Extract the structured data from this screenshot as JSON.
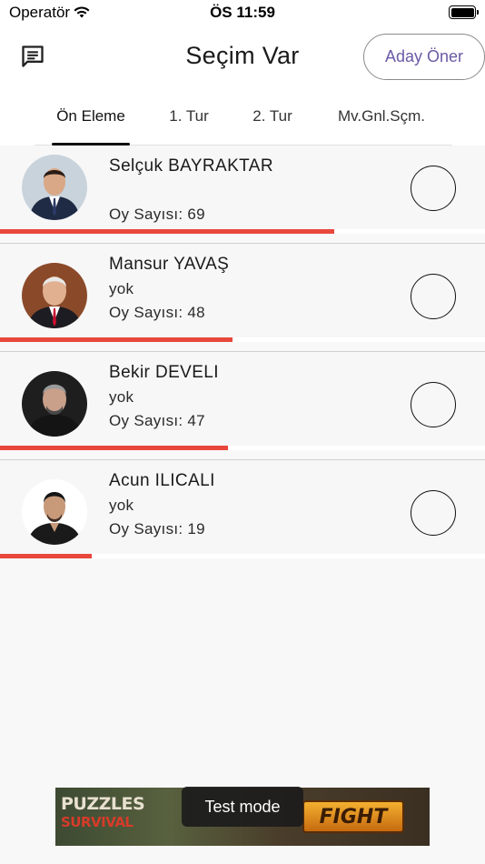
{
  "status_bar": {
    "carrier": "Operatör",
    "time": "ÖS 11:59"
  },
  "header": {
    "title": "Seçim Var",
    "propose_button": "Aday Öner"
  },
  "tabs": [
    {
      "label": "Ön Eleme",
      "active": true
    },
    {
      "label": "1. Tur",
      "active": false
    },
    {
      "label": "2. Tur",
      "active": false
    },
    {
      "label": "Mv.Gnl.Sçm.",
      "active": false
    }
  ],
  "candidates": [
    {
      "name": "Selçuk BAYRAKTAR",
      "description": "",
      "votes": "Oy Sayısı: 69",
      "vote_count": 69,
      "bar_fraction": 0.69
    },
    {
      "name": "Mansur YAVAŞ",
      "description": "yok",
      "votes": "Oy Sayısı: 48",
      "vote_count": 48,
      "bar_fraction": 0.48
    },
    {
      "name": "Bekir DEVELI",
      "description": "yok",
      "votes": "Oy Sayısı: 47",
      "vote_count": 47,
      "bar_fraction": 0.47
    },
    {
      "name": "Acun ILICALI",
      "description": "yok",
      "votes": "Oy Sayısı: 19",
      "vote_count": 19,
      "bar_fraction": 0.19
    }
  ],
  "ad": {
    "logo_line1": "PUZZLES",
    "logo_line2": "SURVIVAL",
    "cta": "FIGHT",
    "toast": "Test mode"
  },
  "colors": {
    "accent": "#6b5aa6",
    "bar": "#e8473c"
  },
  "icons": {
    "chat": "chat-message-icon",
    "wifi": "wifi-icon",
    "battery": "battery-icon"
  }
}
